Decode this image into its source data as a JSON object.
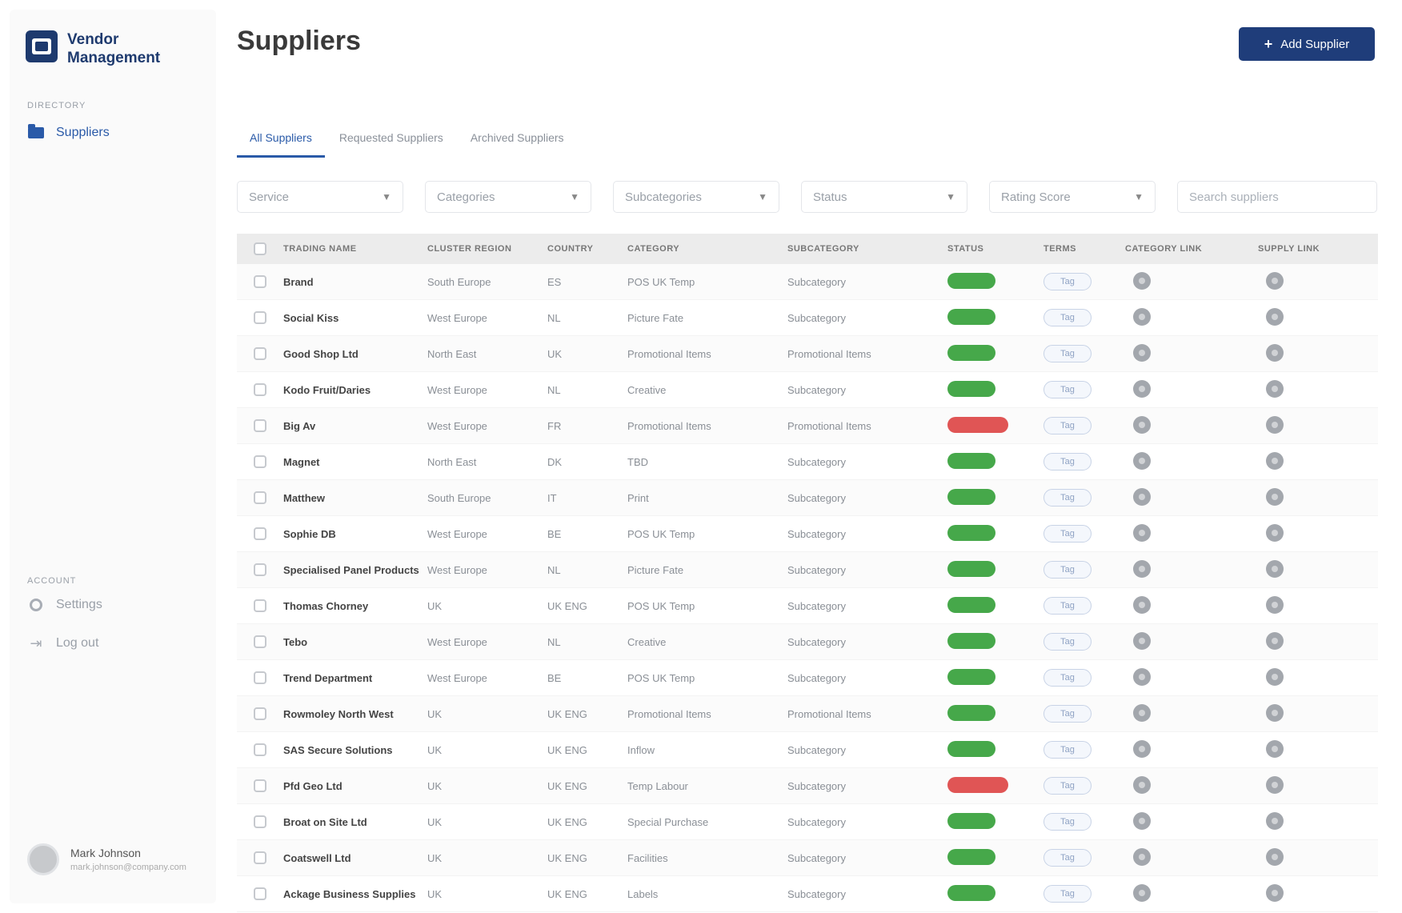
{
  "app": {
    "name": "Vendor Management"
  },
  "sidebar": {
    "section_main": "Directory",
    "items": [
      {
        "label": "Suppliers",
        "icon": "folder-icon"
      }
    ],
    "section_account": "Account",
    "account_items": [
      {
        "label": "Settings",
        "icon": "gear-icon"
      },
      {
        "label": "Log out",
        "icon": "logout-icon"
      }
    ],
    "user": {
      "name": "Mark Johnson",
      "email": "mark.johnson@company.com"
    }
  },
  "header": {
    "title": "Suppliers",
    "add_button": "Add Supplier"
  },
  "tabs": [
    {
      "label": "All Suppliers"
    },
    {
      "label": "Requested Suppliers"
    },
    {
      "label": "Archived Suppliers"
    }
  ],
  "filters": [
    {
      "label": "Service"
    },
    {
      "label": "Categories"
    },
    {
      "label": "Subcategories"
    },
    {
      "label": "Status"
    },
    {
      "label": "Rating Score"
    }
  ],
  "search": {
    "placeholder": "Search suppliers"
  },
  "table": {
    "columns": [
      "TRADING NAME",
      "CLUSTER REGION",
      "COUNTRY",
      "CATEGORY",
      "SUBCATEGORY",
      "STATUS",
      "TERMS",
      "CATEGORY LINK",
      "SUPPLY LINK"
    ],
    "terms_label": "Tag",
    "rows": [
      {
        "name": "Brand",
        "region": "South Europe",
        "country": "ES",
        "category": "POS UK Temp",
        "subcategory": "Subcategory",
        "status": "active"
      },
      {
        "name": "Social Kiss",
        "region": "West Europe",
        "country": "NL",
        "category": "Picture Fate",
        "subcategory": "Subcategory",
        "status": "active"
      },
      {
        "name": "Good Shop Ltd",
        "region": "North East",
        "country": "UK",
        "category": "Promotional Items",
        "subcategory": "Promotional Items",
        "status": "active"
      },
      {
        "name": "Kodo Fruit/Daries",
        "region": "West Europe",
        "country": "NL",
        "category": "Creative",
        "subcategory": "Subcategory",
        "status": "active"
      },
      {
        "name": "Big Av",
        "region": "West Europe",
        "country": "FR",
        "category": "Promotional Items",
        "subcategory": "Promotional Items",
        "status": "inactive"
      },
      {
        "name": "Magnet",
        "region": "North East",
        "country": "DK",
        "category": "TBD",
        "subcategory": "Subcategory",
        "status": "active"
      },
      {
        "name": "Matthew",
        "region": "South Europe",
        "country": "IT",
        "category": "Print",
        "subcategory": "Subcategory",
        "status": "active"
      },
      {
        "name": "Sophie DB",
        "region": "West Europe",
        "country": "BE",
        "category": "POS UK Temp",
        "subcategory": "Subcategory",
        "status": "active"
      },
      {
        "name": "Specialised Panel Products",
        "region": "West Europe",
        "country": "NL",
        "category": "Picture Fate",
        "subcategory": "Subcategory",
        "status": "active"
      },
      {
        "name": "Thomas Chorney",
        "region": "UK",
        "country": "UK ENG",
        "category": "POS UK Temp",
        "subcategory": "Subcategory",
        "status": "active"
      },
      {
        "name": "Tebo",
        "region": "West Europe",
        "country": "NL",
        "category": "Creative",
        "subcategory": "Subcategory",
        "status": "active"
      },
      {
        "name": "Trend Department",
        "region": "West Europe",
        "country": "BE",
        "category": "POS UK Temp",
        "subcategory": "Subcategory",
        "status": "active"
      },
      {
        "name": "Rowmoley North West",
        "region": "UK",
        "country": "UK ENG",
        "category": "Promotional Items",
        "subcategory": "Promotional Items",
        "status": "active"
      },
      {
        "name": "SAS Secure Solutions",
        "region": "UK",
        "country": "UK ENG",
        "category": "Inflow",
        "subcategory": "Subcategory",
        "status": "active"
      },
      {
        "name": "Pfd Geo Ltd",
        "region": "UK",
        "country": "UK ENG",
        "category": "Temp Labour",
        "subcategory": "Subcategory",
        "status": "inactive"
      },
      {
        "name": "Broat on Site Ltd",
        "region": "UK",
        "country": "UK ENG",
        "category": "Special Purchase",
        "subcategory": "Subcategory",
        "status": "active"
      },
      {
        "name": "Coatswell Ltd",
        "region": "UK",
        "country": "UK ENG",
        "category": "Facilities",
        "subcategory": "Subcategory",
        "status": "active"
      },
      {
        "name": "Ackage Business Supplies",
        "region": "UK",
        "country": "UK ENG",
        "category": "Labels",
        "subcategory": "Subcategory",
        "status": "active"
      }
    ]
  },
  "colors": {
    "primary": "#1f3d7a",
    "active": "#46a84a",
    "inactive": "#e05555",
    "accent": "#2a5aa8"
  }
}
